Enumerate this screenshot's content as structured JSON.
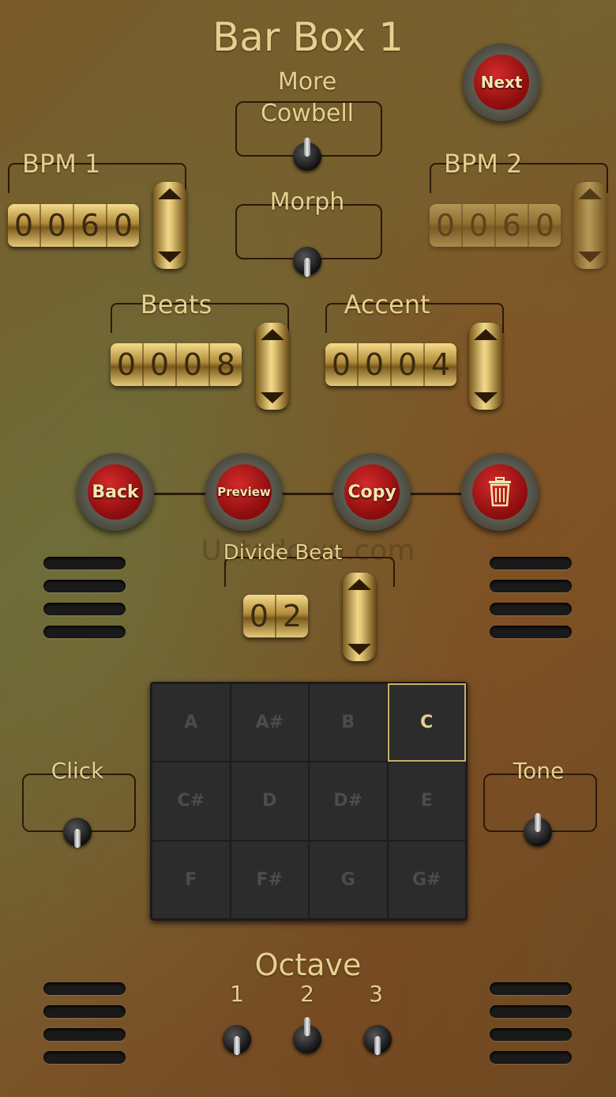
{
  "title": "Bar Box 1",
  "next_label": "Next",
  "cowbell": {
    "line1": "More",
    "line2": "Cowbell"
  },
  "morph_label": "Morph",
  "bpm1": {
    "label": "BPM 1",
    "digits": [
      "0",
      "0",
      "6",
      "0"
    ]
  },
  "bpm2": {
    "label": "BPM 2",
    "digits": [
      "0",
      "0",
      "6",
      "0"
    ]
  },
  "beats": {
    "label": "Beats",
    "digits": [
      "0",
      "0",
      "0",
      "8"
    ]
  },
  "accent": {
    "label": "Accent",
    "digits": [
      "0",
      "0",
      "0",
      "4"
    ]
  },
  "actions": {
    "back": "Back",
    "preview": "Preview",
    "copy": "Copy",
    "trash_icon": "trash-icon"
  },
  "divide": {
    "label": "Divide Beat",
    "digits": [
      "0",
      "2"
    ]
  },
  "watermark": "Uptodown.com",
  "click_label": "Click",
  "tone_label": "Tone",
  "notes": [
    "A",
    "A#",
    "B",
    "C",
    "C#",
    "D",
    "D#",
    "E",
    "F",
    "F#",
    "G",
    "G#"
  ],
  "selected_note": "C",
  "octave": {
    "label": "Octave",
    "options": [
      "1",
      "2",
      "3"
    ],
    "selected": "2"
  }
}
